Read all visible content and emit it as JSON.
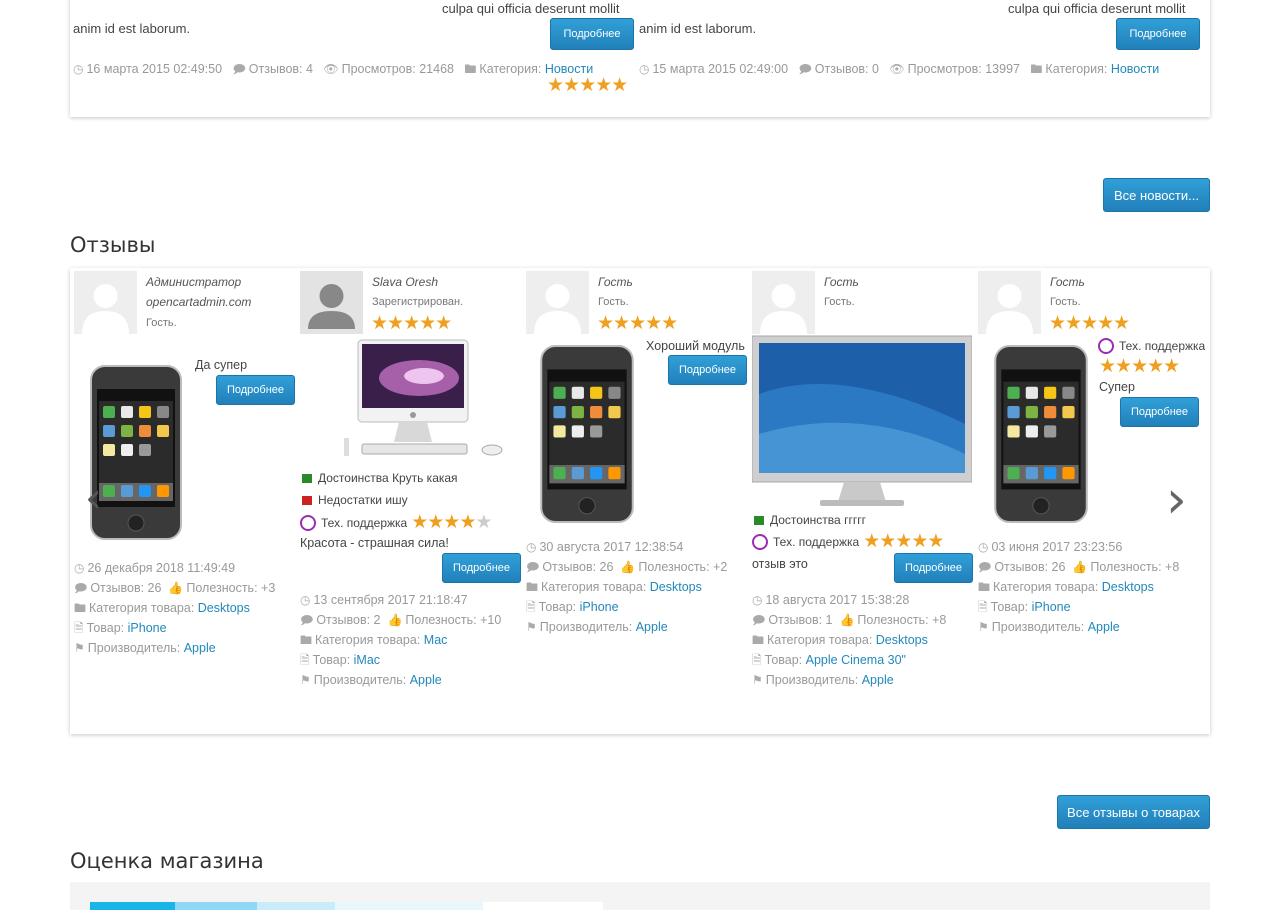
{
  "news": {
    "items": [
      {
        "text_tail": "culpa qui officia deserunt mollit",
        "text_end": "anim id est laborum.",
        "more_label": "Подробнее",
        "date": "16 марта 2015 02:49:50",
        "reviews": "Отзывов: 4",
        "views": "Просмотров: 21468",
        "category_label": "Категория:",
        "category": "Новости",
        "rating": 5
      },
      {
        "text_tail": "culpa qui officia deserunt mollit",
        "text_end": "anim id est laborum.",
        "more_label": "Подробнее",
        "date": "15 марта 2015 02:49:00",
        "reviews": "Отзывов: 0",
        "views": "Просмотров: 13997",
        "category_label": "Категория:",
        "category": "Новости"
      }
    ],
    "all_label": "Все новости..."
  },
  "reviews": {
    "title": "Отзывы",
    "all_label": "Все отзывы о товарах",
    "labels": {
      "more": "Подробнее",
      "pros": "Достоинства",
      "cons": "Недостатки",
      "support": "Тех. поддержка",
      "reviews": "Отзывов:",
      "usefulness": "Полезность:",
      "product_category": "Категория товара:",
      "product": "Товар:",
      "manufacturer": "Производитель:"
    },
    "items": [
      {
        "author": "Администратор",
        "author2": "opencartadmin.com",
        "status": "Гость.",
        "text": "Да супер",
        "date": "26 декабря 2018 11:49:49",
        "reviews_count": "26",
        "usefulness": "+3",
        "category": "Desktops",
        "product": "iPhone",
        "manufacturer": "Apple"
      },
      {
        "author": "Slava Oresh",
        "status": "Зарегистрирован.",
        "rating": 5,
        "pros": "Круть какая",
        "cons": "ишу",
        "support_rating": 4,
        "text": "Красота - страшная сила!",
        "date": "13 сентября 2017 21:18:47",
        "reviews_count": "2",
        "usefulness": "+10",
        "category": "Mac",
        "product": "iMac",
        "manufacturer": "Apple"
      },
      {
        "author": "Гость",
        "status": "Гость.",
        "rating": 5,
        "text": "Хороший модуль",
        "date": "30 августа 2017 12:38:54",
        "reviews_count": "26",
        "usefulness": "+2",
        "category": "Desktops",
        "product": "iPhone",
        "manufacturer": "Apple"
      },
      {
        "author": "Гость",
        "status": "Гость.",
        "pros": "ггггг",
        "support_rating": 5,
        "text": "отзыв это",
        "date": "18 августа 2017 15:38:28",
        "reviews_count": "1",
        "usefulness": "+8",
        "category": "Desktops",
        "product": "Apple Cinema 30\"",
        "manufacturer": "Apple"
      },
      {
        "author": "Гость",
        "status": "Гость.",
        "rating": 5,
        "support_rating": 5,
        "text": "Супер",
        "date": "03 июня 2017 23:23:56",
        "reviews_count": "26",
        "usefulness": "+8",
        "category": "Desktops",
        "product": "iPhone",
        "manufacturer": "Apple"
      }
    ]
  },
  "store_rating": {
    "title": "Оценка магазина"
  },
  "icons": {
    "clock": "clock-icon",
    "comment": "comment-icon",
    "eye": "eye-icon",
    "folder": "folder-icon",
    "thumb": "thumbs-up-icon",
    "file": "file-icon",
    "flag": "flag-icon",
    "next": "chevron-right-icon",
    "prev": "chevron-left-icon",
    "support": "lifebuoy-icon"
  },
  "colors": {
    "accent": "#2b8cc4",
    "link": "#2288bb",
    "star": "#f0a020",
    "support": "#9b2db5",
    "pros": "#2a8a2a",
    "cons": "#cc2222"
  }
}
